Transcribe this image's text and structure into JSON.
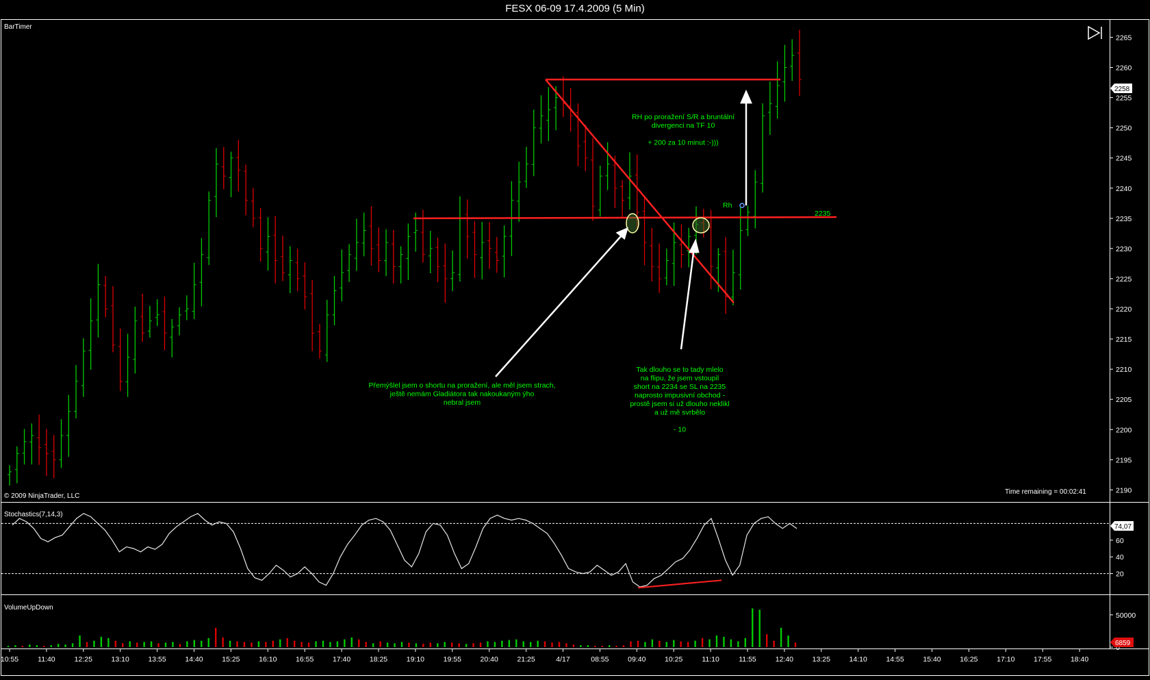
{
  "window": {
    "title": "FESX 06-09  17.4.2009 (5 Min)"
  },
  "labels": {
    "indicator_bartimer": "BarTimer",
    "copyright": "© 2009 NinjaTrader, LLC",
    "time_remaining": "Time remaining = 00:02:41"
  },
  "annotations": {
    "rh_label": "Rh",
    "level_label": "2235",
    "note_top": [
      "RH po proražení S/R a bruntální",
      "divergenci na TF 10",
      "",
      "+ 200 za 10 minut :-)))"
    ],
    "note_left": [
      "Přemýšlel jsem o shortu na proražení, ale měl jsem strach,",
      "ještě nemám Gladiátora tak nakoukaným ýho",
      "nebral jsem"
    ],
    "note_right": [
      "Tak dlouho se to tady mlelo",
      "na flipu, že jsem vstoupil",
      "short na 2234 se SL na 2235",
      "naprosto impusivní obchod -",
      "prostě jsem si už dlouho neklikl",
      "a už mě svrbělo",
      "",
      "- 10"
    ]
  },
  "colors": {
    "up": "#00cc00",
    "down": "#dd0000",
    "line": "#ff2020",
    "text_green": "#00ff00"
  },
  "chart_data": [
    {
      "type": "ohlc",
      "title": "FESX 06-09  17.4.2009 (5 Min)",
      "ylim": [
        2188,
        2268
      ],
      "y_ticks": [
        2190,
        2195,
        2200,
        2205,
        2210,
        2215,
        2220,
        2225,
        2230,
        2235,
        2240,
        2245,
        2250,
        2255,
        2260,
        2265
      ],
      "last_price": "2258",
      "x_ticks": [
        "10:55",
        "11:40",
        "12:25",
        "13:10",
        "13:55",
        "14:40",
        "15:25",
        "16:10",
        "16:55",
        "17:40",
        "18:25",
        "19:10",
        "19:55",
        "20:40",
        "21:25",
        "4/17",
        "08:55",
        "09:40",
        "10:25",
        "11:10",
        "11:55",
        "12:40",
        "13:25",
        "14:10",
        "14:55",
        "15:40",
        "16:25",
        "17:10",
        "17:55",
        "18:40"
      ],
      "bars_anchor": [
        2193,
        2196,
        2198,
        2199,
        2197,
        2196,
        2195,
        2199,
        2203,
        2208,
        2213,
        2218,
        2224,
        2220,
        2214,
        2208,
        2212,
        2218,
        2216,
        2218,
        2219,
        2216,
        2217,
        2219,
        2220,
        2224,
        2229,
        2238,
        2244,
        2242,
        2245,
        2243,
        2238,
        2235,
        2230,
        2232,
        2228,
        2226,
        2228,
        2225,
        2222,
        2216,
        2213,
        2219,
        2223,
        2226,
        2229,
        2231,
        2233,
        2230,
        2228,
        2231,
        2227,
        2229,
        2232,
        2233,
        2229,
        2230,
        2227,
        2225,
        2226,
        2235,
        2232,
        2229,
        2231,
        2230,
        2228,
        2232,
        2238,
        2241,
        2244,
        2250,
        2252,
        2253,
        2255,
        2254,
        2252,
        2247,
        2245,
        2237,
        2242,
        2244,
        2240,
        2238,
        2242,
        2236,
        2231,
        2227,
        2225,
        2228,
        2231,
        2229,
        2232,
        2234,
        2233,
        2227,
        2229,
        2222,
        2226,
        2233,
        2236,
        2241,
        2252,
        2254,
        2257,
        2260,
        2262,
        2258
      ],
      "drawn_lines": [
        {
          "name": "support-resistance-2235",
          "from": [
            1,
            2235
          ],
          "to": [
            1,
            2235
          ]
        },
        {
          "name": "resistance-high",
          "from": [
            1,
            2258
          ],
          "to": [
            1,
            2258
          ]
        },
        {
          "name": "downtrend-line",
          "from": [
            1,
            2258
          ],
          "to": [
            1,
            2221
          ]
        }
      ]
    },
    {
      "type": "line",
      "title": "Stochastics(7,14,3)",
      "ylim": [
        0,
        100
      ],
      "y_ticks": [
        20,
        40,
        60
      ],
      "levels": [
        20,
        80
      ],
      "last_value": "74,07",
      "values": [
        78,
        86,
        82,
        74,
        62,
        58,
        63,
        66,
        76,
        86,
        92,
        88,
        80,
        72,
        60,
        46,
        52,
        50,
        46,
        52,
        49,
        55,
        68,
        76,
        82,
        88,
        92,
        84,
        78,
        82,
        80,
        70,
        50,
        26,
        15,
        12,
        20,
        30,
        24,
        16,
        20,
        28,
        20,
        10,
        6,
        20,
        40,
        55,
        66,
        78,
        84,
        86,
        82,
        72,
        54,
        36,
        28,
        44,
        70,
        80,
        78,
        66,
        44,
        26,
        32,
        52,
        74,
        86,
        90,
        86,
        84,
        86,
        84,
        80,
        74,
        68,
        56,
        42,
        26,
        22,
        20,
        22,
        30,
        24,
        18,
        22,
        32,
        10,
        4,
        6,
        14,
        18,
        26,
        34,
        38,
        48,
        62,
        78,
        86,
        62,
        36,
        18,
        30,
        66,
        80,
        86,
        88,
        80,
        74,
        80,
        74
      ]
    },
    {
      "type": "bar",
      "title": "VolumeUpDown",
      "y_ticks": [
        0,
        50000
      ],
      "last_value": "6859",
      "values": [
        2,
        3,
        2,
        4,
        3,
        2,
        3,
        5,
        4,
        6,
        18,
        8,
        10,
        16,
        14,
        10,
        6,
        9,
        7,
        8,
        9,
        6,
        7,
        8,
        5,
        9,
        11,
        10,
        14,
        30,
        15,
        10,
        9,
        8,
        7,
        9,
        8,
        10,
        12,
        14,
        10,
        8,
        7,
        9,
        10,
        8,
        9,
        12,
        15,
        12,
        8,
        6,
        9,
        7,
        6,
        8,
        7,
        6,
        5,
        7,
        6,
        8,
        7,
        6,
        5,
        6,
        7,
        9,
        8,
        10,
        11,
        12,
        9,
        8,
        10,
        9,
        7,
        8,
        6,
        4,
        3,
        3,
        2,
        2,
        3,
        2,
        3,
        9,
        10,
        8,
        12,
        10,
        8,
        11,
        9,
        8,
        10,
        14,
        12,
        18,
        16,
        12,
        9,
        14,
        60,
        58,
        20,
        10,
        30,
        18,
        7
      ],
      "up_down": [
        1,
        1,
        0,
        1,
        1,
        0,
        1,
        1,
        1,
        1,
        1,
        0,
        1,
        1,
        1,
        0,
        0,
        1,
        0,
        1,
        1,
        0,
        1,
        1,
        0,
        1,
        1,
        1,
        1,
        0,
        0,
        1,
        0,
        0,
        0,
        1,
        0,
        0,
        1,
        0,
        0,
        0,
        0,
        1,
        1,
        1,
        1,
        1,
        1,
        0,
        0,
        1,
        0,
        1,
        1,
        1,
        0,
        1,
        0,
        0,
        1,
        1,
        0,
        0,
        1,
        0,
        0,
        1,
        1,
        1,
        1,
        1,
        1,
        1,
        1,
        0,
        0,
        0,
        0,
        0,
        1,
        1,
        0,
        0,
        1,
        0,
        0,
        0,
        0,
        1,
        1,
        0,
        1,
        1,
        0,
        0,
        1,
        0,
        1,
        1,
        1,
        1,
        1,
        1,
        1,
        1,
        0,
        0,
        1,
        1,
        0
      ]
    }
  ]
}
